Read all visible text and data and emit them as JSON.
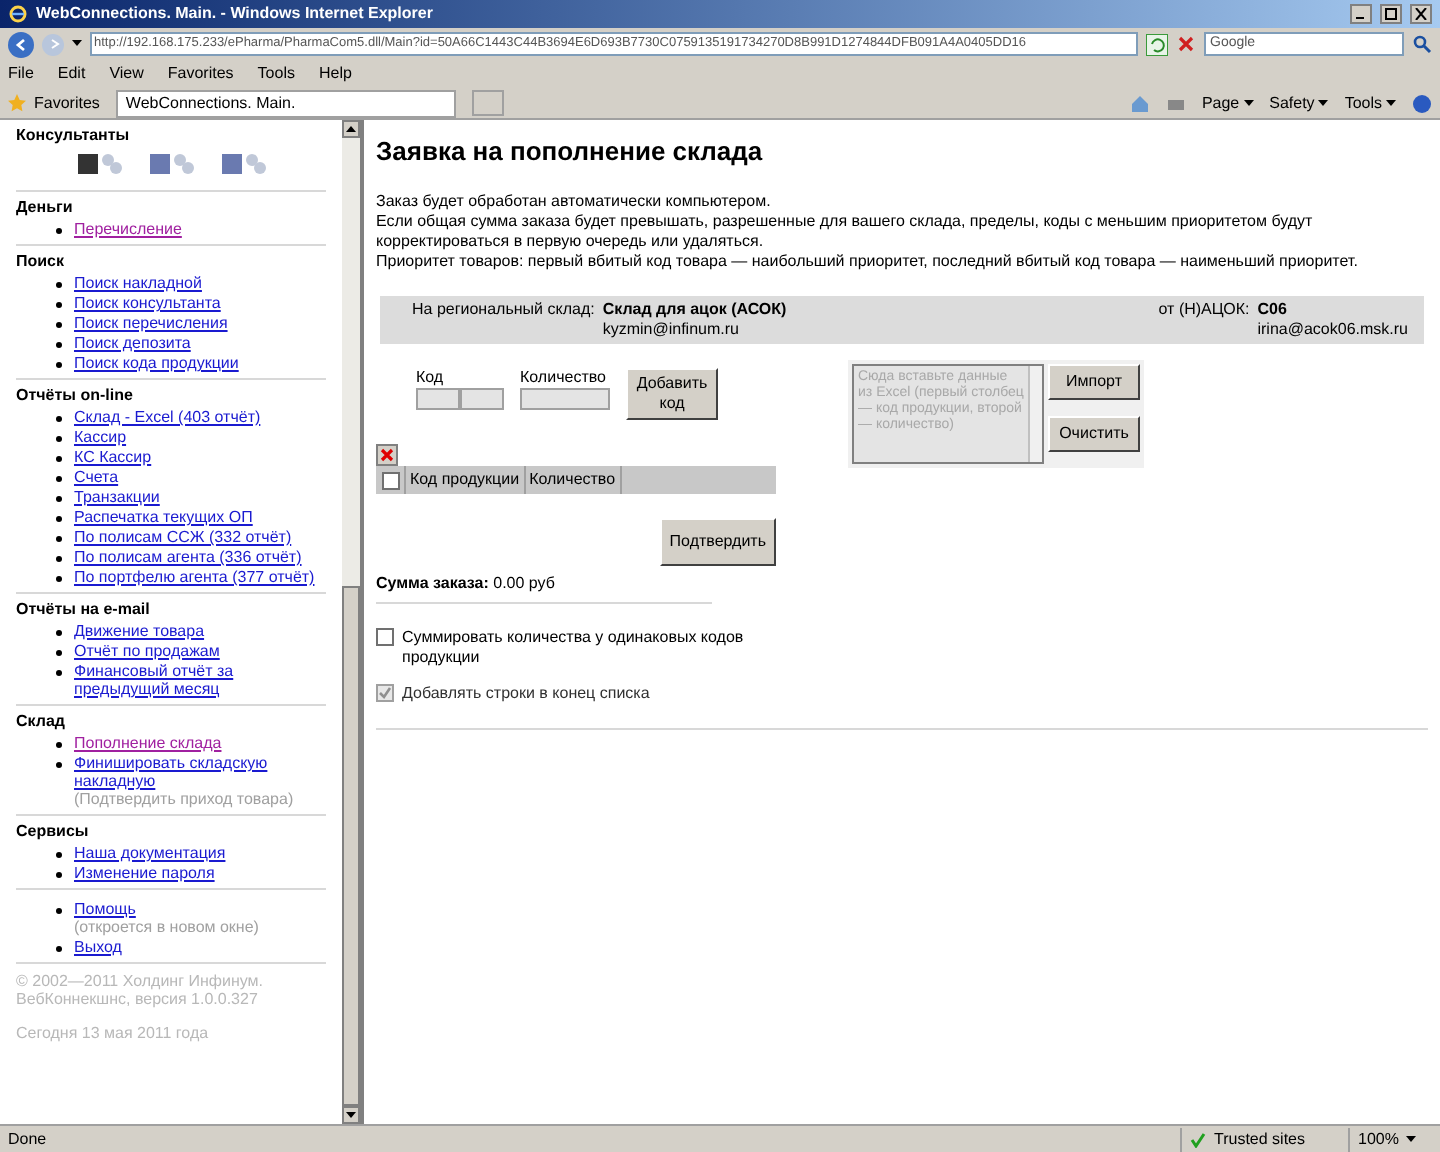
{
  "window": {
    "title": "WebConnections. Main. - Windows Internet Explorer"
  },
  "address_bar": {
    "url": "http://192.168.175.233/ePharma/PharmaCom5.dll/Main?id=50A66C1443C44B3694E6D693B7730C0759135191734270D8B991D1274844DFB091A4A0405DD16"
  },
  "search": {
    "placeholder": "Google"
  },
  "menu": [
    "File",
    "Edit",
    "View",
    "Favorites",
    "Tools",
    "Help"
  ],
  "favorites_bar": {
    "favorites": "Favorites",
    "tab": "WebConnections. Main.",
    "commands": [
      "Page",
      "Safety",
      "Tools"
    ]
  },
  "sidebar": {
    "sections": [
      {
        "heading": "Консультанты",
        "kind": "icons"
      },
      {
        "heading": "Деньги",
        "kind": "links",
        "items": [
          {
            "text": "Перечисление",
            "visited": true
          }
        ]
      },
      {
        "heading": "Поиск",
        "kind": "links",
        "items": [
          {
            "text": "Поиск накладной",
            "visited": false
          },
          {
            "text": "Поиск консультанта",
            "visited": false
          },
          {
            "text": "Поиск перечисления",
            "visited": false
          },
          {
            "text": "Поиск депозита",
            "visited": false
          },
          {
            "text": "Поиск кода продукции",
            "visited": false
          }
        ]
      },
      {
        "heading": "Отчёты on-line",
        "kind": "links",
        "items": [
          {
            "text": "Склад - Excel (403 отчёт)",
            "visited": false
          },
          {
            "text": "Кассир",
            "visited": false
          },
          {
            "text": "КС Кассир",
            "visited": false
          },
          {
            "text": "Счета",
            "visited": false
          },
          {
            "text": "Транзакции",
            "visited": false
          },
          {
            "text": "Распечатка текущих ОП",
            "visited": false
          },
          {
            "text": "По полисам ССЖ (332 отчёт)",
            "visited": false
          },
          {
            "text": "По полисам агента (336 отчёт)",
            "visited": false
          },
          {
            "text": "По портфелю агента (377 отчёт)",
            "visited": false
          }
        ]
      },
      {
        "heading": "Отчёты на e-mail",
        "kind": "links",
        "items": [
          {
            "text": "Движение товара",
            "visited": false
          },
          {
            "text": "Отчёт по продажам",
            "visited": false
          },
          {
            "text": "Финансовый отчёт за предыдущий месяц",
            "visited": false
          }
        ]
      },
      {
        "heading": "Склад",
        "kind": "links",
        "items": [
          {
            "text": "Пополнение склада",
            "visited": true
          },
          {
            "text": "Финишировать складскую накладную",
            "visited": false,
            "note": "(Подтвердить приход товара)"
          }
        ]
      },
      {
        "heading": "Сервисы",
        "kind": "links",
        "items": [
          {
            "text": "Наша документация",
            "visited": false
          },
          {
            "text": "Изменение пароля",
            "visited": false
          }
        ]
      },
      {
        "kind": "links",
        "items": [
          {
            "text": "Помощь",
            "visited": false,
            "note": "(откроется в новом окне)"
          },
          {
            "text": "Выход",
            "visited": false
          }
        ]
      }
    ],
    "footer": [
      "© 2002—2011 Холдинг Инфинум. ВебКоннекшнс, версия 1.0.0.327",
      "Сегодня 13 мая 2011 года"
    ]
  },
  "main": {
    "title": "Заявка на пополнение склада",
    "intro": [
      "Заказ будет обработан автоматически компьютером.",
      "Если общая сумма заказа будет превышать, разрешенные для вашего склада, пределы, коды с меньшим приоритетом будут корректироваться в первую очередь или удаляться.",
      "Приоритет товаров: первый вбитый код товара — наибольший приоритет, последний вбитый код товара — наименьший приоритет."
    ],
    "info": {
      "to_label": "На региональный склад:",
      "to_name": "Склад для ацок (АСОК)",
      "to_email": "kyzmin@infinum.ru",
      "from_label": "от (Н)АЦОК:",
      "from_name": "С06",
      "from_email": "irina@acok06.msk.ru"
    },
    "code_label": "Код",
    "quantity_label": "Количество",
    "add_button": "Добавить код",
    "paste_placeholder": "Сюда вставьте данные из Excel (первый столбец — код продукции, второй — количество)",
    "import_button": "Импорт",
    "clear_button": "Очистить",
    "table": {
      "select_all": false,
      "columns": [
        "Код продукции",
        "Количество"
      ]
    },
    "confirm_button": "Подтвердить",
    "total_label": "Сумма заказа:",
    "total_value": "0.00 руб",
    "options": [
      {
        "label": "Суммировать количества у одинаковых кодов продукции",
        "checked": false,
        "disabled": false
      },
      {
        "label": "Добавлять строки в конец списка",
        "checked": true,
        "disabled": true
      }
    ]
  },
  "status_bar": {
    "status": "Done",
    "zone": "Trusted sites",
    "zoom": "100%"
  }
}
